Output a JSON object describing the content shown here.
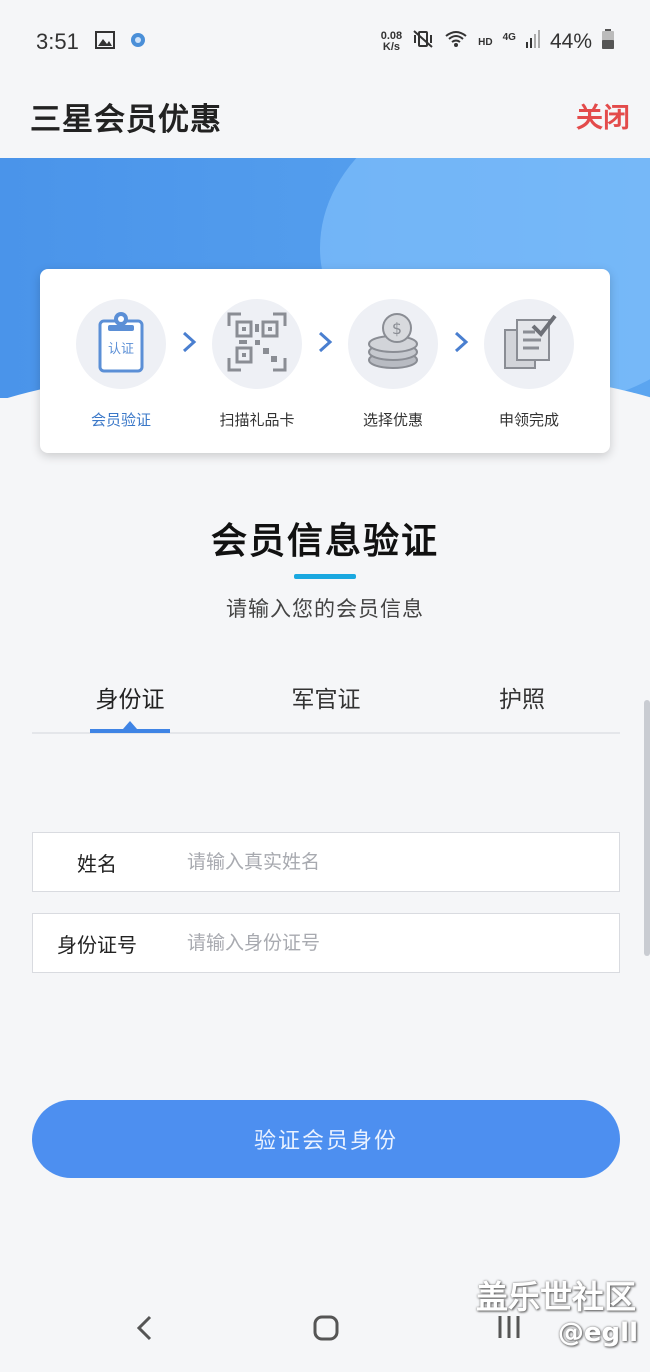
{
  "status_bar": {
    "time": "3:51",
    "net_speed_value": "0.08",
    "net_speed_unit": "K/s",
    "network_hd": "HD",
    "network_type": "4G",
    "battery": "44%"
  },
  "header": {
    "title": "三星会员优惠",
    "close_label": "关闭"
  },
  "steps": [
    {
      "label": "会员验证",
      "badge": "认证",
      "icon": "clipboard-badge-icon",
      "active": true
    },
    {
      "label": "扫描礼品卡",
      "icon": "qr-code-icon",
      "active": false
    },
    {
      "label": "选择优惠",
      "icon": "coins-icon",
      "active": false
    },
    {
      "label": "申领完成",
      "icon": "document-check-icon",
      "active": false
    }
  ],
  "section": {
    "title": "会员信息验证",
    "subtitle": "请输入您的会员信息"
  },
  "tabs": [
    {
      "label": "身份证",
      "selected": true
    },
    {
      "label": "军官证",
      "selected": false
    },
    {
      "label": "护照",
      "selected": false
    }
  ],
  "form": {
    "name_label": "姓名",
    "name_placeholder": "请输入真实姓名",
    "name_value": "",
    "id_label": "身份证号",
    "id_placeholder": "请输入身份证号",
    "id_value": ""
  },
  "submit_label": "验证会员身份",
  "watermark": {
    "site": "盖乐世社区",
    "user": "@egll"
  },
  "colors": {
    "accent": "#4d8ff0",
    "close": "#e34b4b",
    "underline": "#1aa8e0",
    "hero": "#4a94ea"
  }
}
